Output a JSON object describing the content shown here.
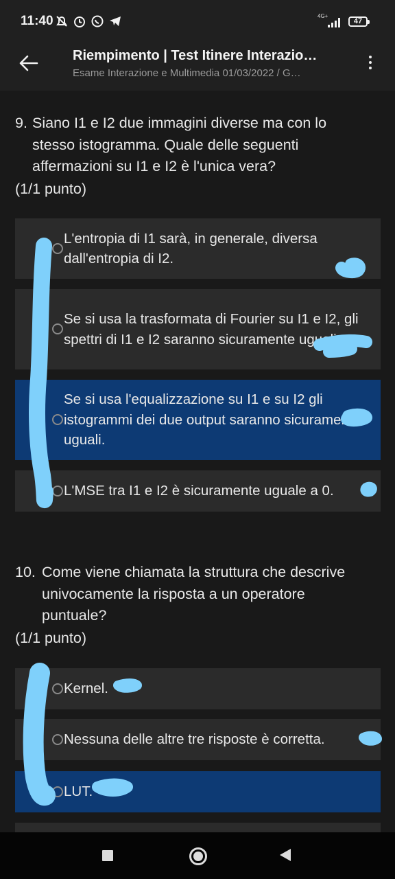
{
  "status_bar": {
    "time": "11:40",
    "network": "4G+",
    "battery": "47"
  },
  "app_bar": {
    "title": "Riempimento | Test Itinere Interazio…",
    "subtitle": "Esame Interazione e Multimedia 01/03/2022 / G…"
  },
  "questions": [
    {
      "number": "9.",
      "text": "Siano I1 e I2 due immagini diverse ma con lo stesso istogramma. Quale delle seguenti affermazioni su I1 e I2 è l'unica vera?",
      "points": "(1/1 punto)",
      "options": [
        {
          "text": "L'entropia di I1 sarà, in generale, diversa dall'entropia di I2.",
          "selected": false
        },
        {
          "text": "Se si usa la trasformata di Fourier su I1 e I2, gli spettri di I1 e I2 saranno sicuramente uguali.",
          "selected": false
        },
        {
          "text": "Se si usa l'equalizzazione su I1 e su I2 gli istogrammi dei due output saranno sicuramente uguali.",
          "selected": true
        },
        {
          "text": "L'MSE tra I1 e I2 è sicuramente uguale a 0.",
          "selected": false
        }
      ]
    },
    {
      "number": "10.",
      "text": "Come viene chiamata la struttura che descrive univocamente la risposta a un operatore puntuale?",
      "points": "(1/1 punto)",
      "options": [
        {
          "text": "Kernel.",
          "selected": false
        },
        {
          "text": "Nessuna delle altre tre risposte è corretta.",
          "selected": false
        },
        {
          "text": "LUT.",
          "selected": true
        }
      ]
    }
  ],
  "colors": {
    "background": "#191919",
    "bar_background": "#202020",
    "option_background": "#2b2b2b",
    "selected_option": "#0d3a74",
    "scribble": "#7fd0fb"
  },
  "nav_icons": [
    "recents-square-icon",
    "home-circle-icon",
    "back-triangle-icon"
  ]
}
